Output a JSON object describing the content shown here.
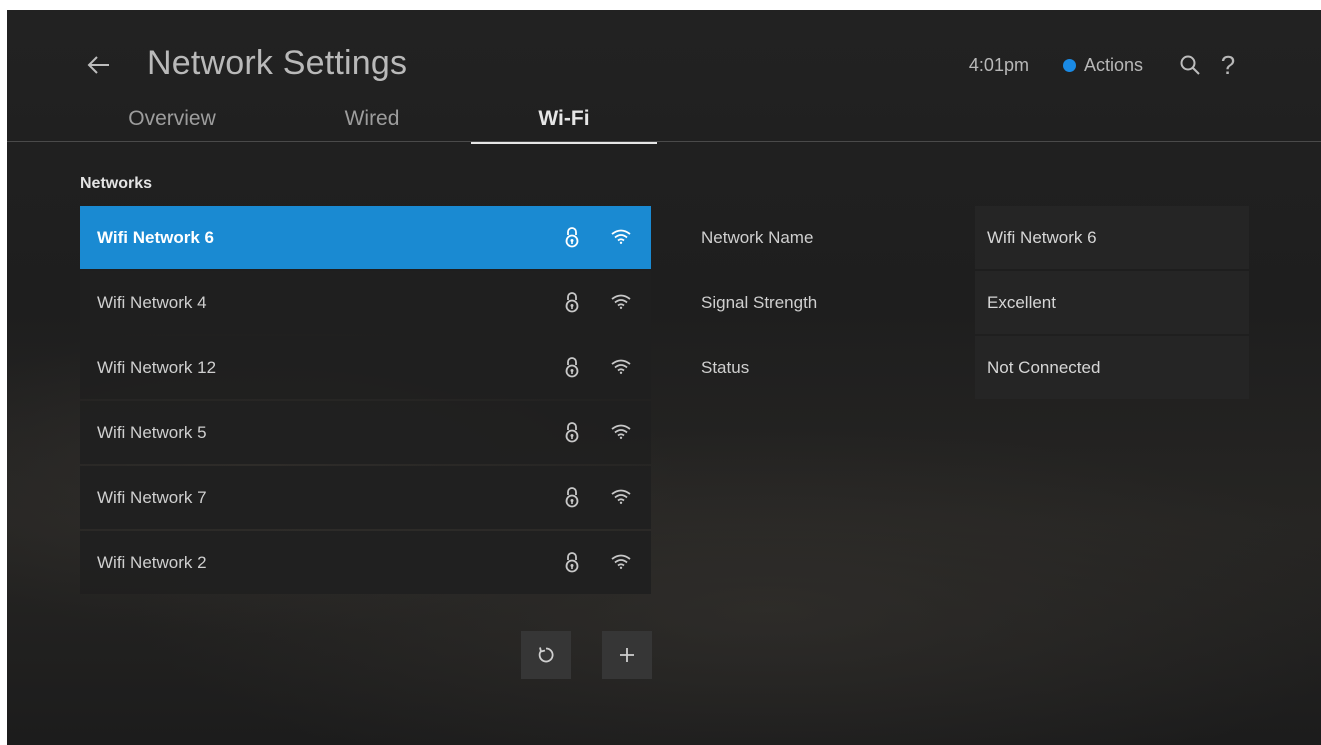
{
  "header": {
    "title": "Network Settings",
    "time": "4:01pm",
    "actions_label": "Actions",
    "help_glyph": "?",
    "accent_color": "#1a8ae5"
  },
  "tabs": [
    {
      "label": "Overview",
      "active": false
    },
    {
      "label": "Wired",
      "active": false
    },
    {
      "label": "Wi-Fi",
      "active": true
    }
  ],
  "networks": {
    "section_label": "Networks",
    "items": [
      {
        "name": "Wifi Network 6",
        "selected": true,
        "icons": [
          "lock-icon",
          "wifi-icon"
        ]
      },
      {
        "name": "Wifi Network 4",
        "selected": false,
        "icons": [
          "lock-icon",
          "wifi-icon"
        ]
      },
      {
        "name": "Wifi Network 12",
        "selected": false,
        "icons": [
          "lock-icon",
          "wifi-icon"
        ]
      },
      {
        "name": "Wifi Network 5",
        "selected": false,
        "icons": [
          "lock-icon",
          "wifi-icon"
        ]
      },
      {
        "name": "Wifi Network 7",
        "selected": false,
        "icons": [
          "lock-icon",
          "wifi-icon"
        ]
      },
      {
        "name": "Wifi Network 2",
        "selected": false,
        "icons": [
          "lock-icon",
          "wifi-icon"
        ]
      }
    ],
    "buttons": [
      "refresh-icon",
      "plus-icon"
    ]
  },
  "details": [
    {
      "label": "Network Name",
      "value": "Wifi Network 6"
    },
    {
      "label": "Signal Strength",
      "value": "Excellent"
    },
    {
      "label": "Status",
      "value": "Not Connected"
    }
  ]
}
